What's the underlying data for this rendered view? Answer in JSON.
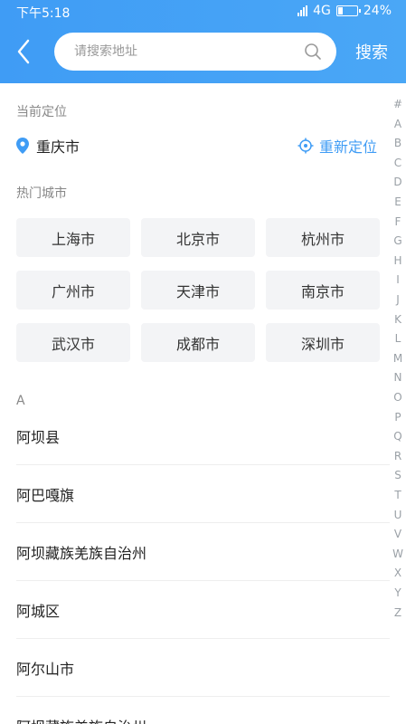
{
  "status_bar": {
    "time": "下午5:18",
    "network": "4G",
    "battery": "24%",
    "battery_level": 0.24
  },
  "header": {
    "search_placeholder": "请搜索地址",
    "search_label": "搜索"
  },
  "current_location": {
    "label": "当前定位",
    "city": "重庆市",
    "relocate_label": "重新定位"
  },
  "hot_cities": {
    "label": "热门城市",
    "items": [
      "上海市",
      "北京市",
      "杭州市",
      "广州市",
      "天津市",
      "南京市",
      "武汉市",
      "成都市",
      "深圳市"
    ]
  },
  "city_list": {
    "group": "A",
    "items": [
      "阿坝县",
      "阿巴嘎旗",
      "阿坝藏族羌族自治州",
      "阿城区",
      "阿尔山市",
      "阿坝藏族羌族自治州"
    ]
  },
  "index_letters": [
    "#",
    "A",
    "B",
    "C",
    "D",
    "E",
    "F",
    "G",
    "H",
    "I",
    "J",
    "K",
    "L",
    "M",
    "N",
    "O",
    "P",
    "Q",
    "R",
    "S",
    "T",
    "U",
    "V",
    "W",
    "X",
    "Y",
    "Z"
  ],
  "colors": {
    "header": "#3f9cf5",
    "accent": "#3f9cf5"
  }
}
